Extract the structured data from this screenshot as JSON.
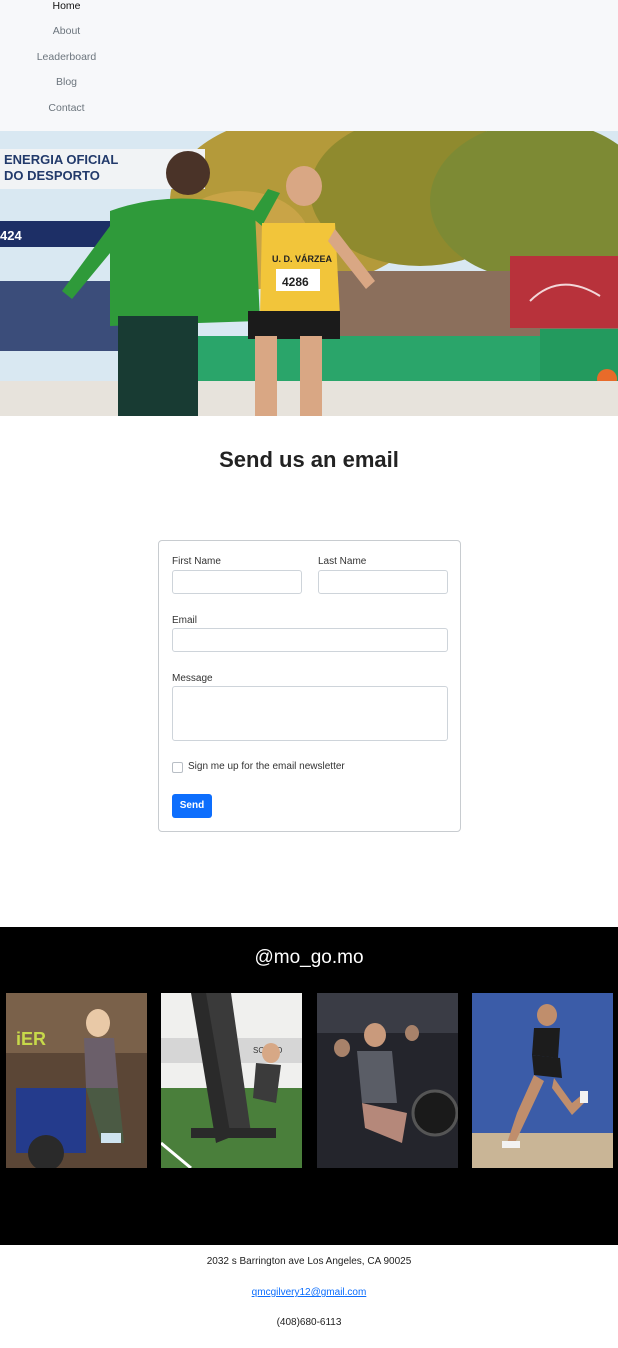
{
  "nav": {
    "items": [
      {
        "label": "Home"
      },
      {
        "label": "About"
      },
      {
        "label": "Leaderboard"
      },
      {
        "label": "Blog"
      },
      {
        "label": "Contact"
      }
    ]
  },
  "hero": {
    "banner_text_1": "ENERGIA OFICIAL",
    "banner_text_2": "DO DESPORTO",
    "bib_number": "4286",
    "jersey_text": "U. D. VÁRZEA",
    "side_number": "424"
  },
  "email_section": {
    "title": "Send us an email",
    "first_name_label": "First Name",
    "last_name_label": "Last Name",
    "email_label": "Email",
    "message_label": "Message",
    "first_name_value": "",
    "last_name_value": "",
    "email_value": "",
    "message_value": "",
    "newsletter_label": "Sign me up for the email newsletter",
    "newsletter_checked": false,
    "send_label": "Send"
  },
  "instagram": {
    "handle": "@mo_go.mo",
    "photos": [
      {
        "alt": "woman on air bike",
        "text": "iER"
      },
      {
        "alt": "athlete pushing sled on turf",
        "text": "SCHOO"
      },
      {
        "alt": "people rowing in gym"
      },
      {
        "alt": "woman running by blue wall"
      }
    ]
  },
  "footer": {
    "address": "2032 s Barrington ave Los Angeles, CA 90025",
    "email": "qmcgilvery12@gmail.com",
    "phone": "(408)680-6113"
  },
  "colors": {
    "accent": "#0d6efd",
    "nav_bg": "#f7f8fa",
    "insta_bg": "#000000"
  }
}
